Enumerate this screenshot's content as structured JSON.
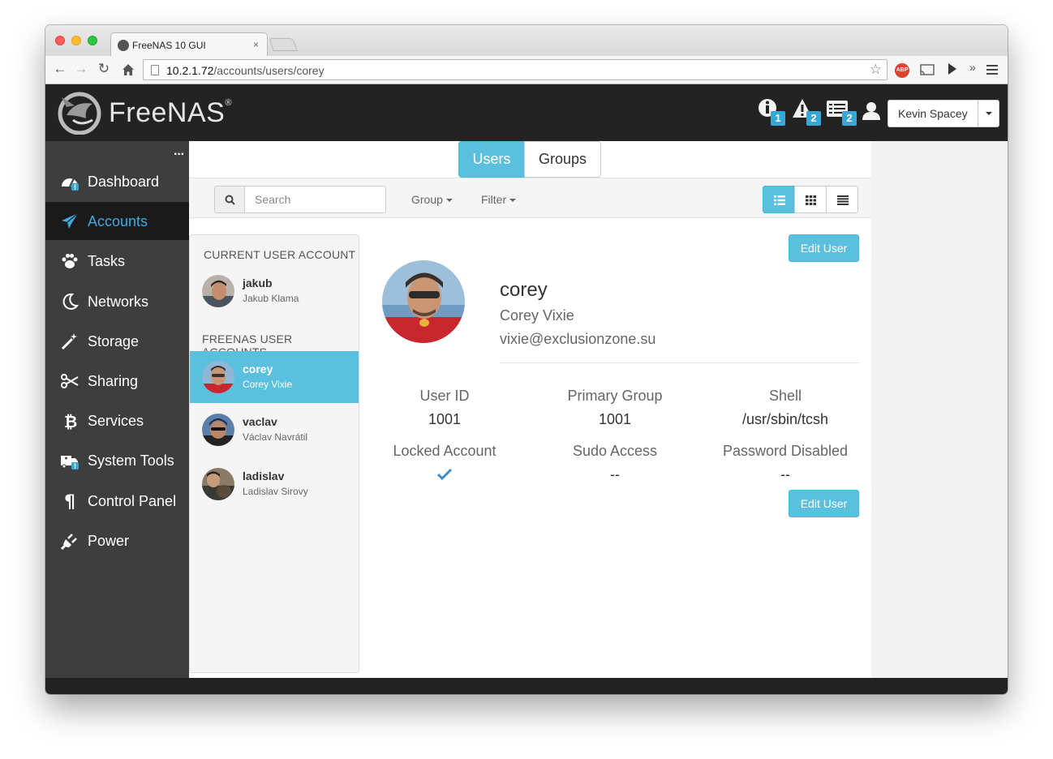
{
  "browser": {
    "tab_title": "FreeNAS 10 GUI",
    "tab_close": "×",
    "url_host": "10.2.1.72",
    "url_path": "/accounts/users/corey",
    "abp_label": "ABP",
    "overflow": "»"
  },
  "header": {
    "brand": "FreeNAS",
    "brand_mark": "®",
    "notifications": [
      {
        "icon": "info-icon",
        "count": "1"
      },
      {
        "icon": "warning-icon",
        "count": "2"
      },
      {
        "icon": "tasks-icon",
        "count": "2"
      }
    ],
    "user_name": "Kevin Spacey"
  },
  "sidebar": {
    "more": "···",
    "items": [
      {
        "label": "Dashboard",
        "icon": "dashboard-icon"
      },
      {
        "label": "Accounts",
        "icon": "paper-plane-icon",
        "active": true
      },
      {
        "label": "Tasks",
        "icon": "paw-icon"
      },
      {
        "label": "Networks",
        "icon": "moon-icon"
      },
      {
        "label": "Storage",
        "icon": "magic-wand-icon"
      },
      {
        "label": "Sharing",
        "icon": "scissors-icon"
      },
      {
        "label": "Services",
        "icon": "bitcoin-icon"
      },
      {
        "label": "System Tools",
        "icon": "ambulance-icon"
      },
      {
        "label": "Control Panel",
        "icon": "paragraph-icon"
      },
      {
        "label": "Power",
        "icon": "plug-icon"
      }
    ]
  },
  "tabs": {
    "users": "Users",
    "groups": "Groups"
  },
  "filterbar": {
    "search_placeholder": "Search",
    "group_label": "Group",
    "filter_label": "Filter"
  },
  "userlist": {
    "current_heading": "CURRENT USER ACCOUNT",
    "freenas_heading": "FREENAS USER ACCOUNTS",
    "current": {
      "username": "jakub",
      "fullname": "Jakub Klama"
    },
    "users": [
      {
        "username": "corey",
        "fullname": "Corey Vixie",
        "active": true
      },
      {
        "username": "vaclav",
        "fullname": "Václav Navrátil"
      },
      {
        "username": "ladislav",
        "fullname": "Ladislav Sirovy"
      }
    ]
  },
  "detail": {
    "edit_label": "Edit User",
    "username": "corey",
    "fullname": "Corey Vixie",
    "email": "vixie@exclusionzone.su",
    "fields": {
      "user_id_label": "User ID",
      "user_id": "1001",
      "primary_group_label": "Primary Group",
      "primary_group": "1001",
      "shell_label": "Shell",
      "shell": "/usr/sbin/tcsh",
      "locked_label": "Locked Account",
      "locked": true,
      "sudo_label": "Sudo Access",
      "sudo": "--",
      "password_disabled_label": "Password Disabled",
      "password_disabled": "--"
    }
  },
  "colors": {
    "accent": "#5bc0de",
    "sidebar_bg": "#3e3e3e",
    "header_bg": "#232323",
    "active_link": "#3fa9e0",
    "badge": "#37a8d6"
  }
}
